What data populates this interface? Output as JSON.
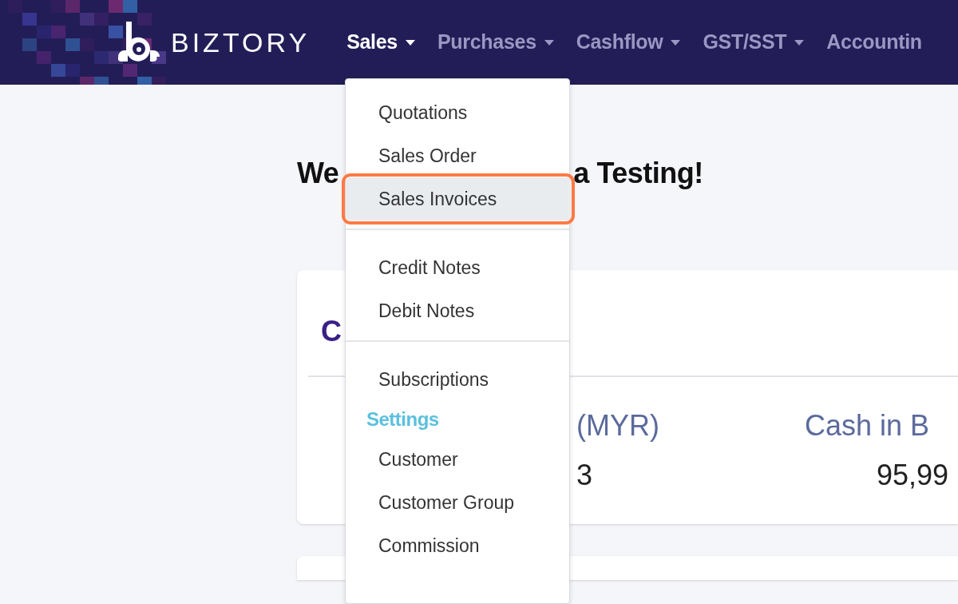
{
  "nav": {
    "brand": "BIZTORY",
    "items": [
      {
        "label": "Sales",
        "selected": true,
        "caret": true
      },
      {
        "label": "Purchases",
        "selected": false,
        "caret": true
      },
      {
        "label": "Cashflow",
        "selected": false,
        "caret": true
      },
      {
        "label": "GST/SST",
        "selected": false,
        "caret": true
      },
      {
        "label": "Accountin",
        "selected": false,
        "caret": false
      }
    ]
  },
  "dropdown": {
    "items": [
      {
        "kind": "item",
        "label": "Quotations",
        "selected": false
      },
      {
        "kind": "item",
        "label": "Sales Order",
        "selected": false
      },
      {
        "kind": "item",
        "label": "Sales Invoices",
        "selected": true
      },
      {
        "kind": "divider"
      },
      {
        "kind": "item",
        "label": "Credit Notes",
        "selected": false
      },
      {
        "kind": "item",
        "label": "Debit Notes",
        "selected": false
      },
      {
        "kind": "divider"
      },
      {
        "kind": "item",
        "label": "Subscriptions",
        "selected": false
      },
      {
        "kind": "header",
        "label": "Settings"
      },
      {
        "kind": "item",
        "label": "Customer",
        "selected": false
      },
      {
        "kind": "item",
        "label": "Customer Group",
        "selected": false
      },
      {
        "kind": "item",
        "label": "Commission",
        "selected": false
      }
    ]
  },
  "welcome": [
    "We",
    "a Testing!"
  ],
  "card": {
    "title": "C",
    "stats": [
      {
        "label": "(MYR)",
        "value": "3"
      },
      {
        "label": "Cash in B",
        "value": "95,99"
      }
    ]
  }
}
